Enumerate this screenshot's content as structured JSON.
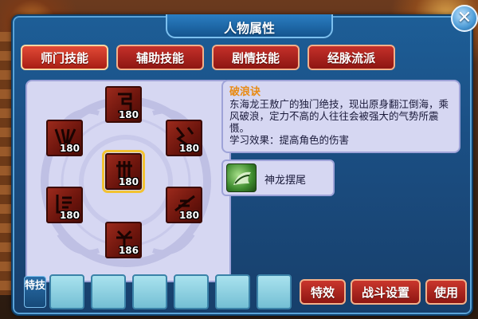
{
  "window": {
    "title": "人物属性"
  },
  "tabs": [
    {
      "label": "师门技能",
      "active": true
    },
    {
      "label": "辅助技能",
      "active": false
    },
    {
      "label": "剧情技能",
      "active": false
    },
    {
      "label": "经脉流派",
      "active": false
    }
  ],
  "skills": [
    {
      "level": "180",
      "icon": "dragon-seal-icon"
    },
    {
      "level": "180",
      "icon": "wave-seal-icon"
    },
    {
      "level": "180",
      "icon": "lightning-seal-icon"
    },
    {
      "level": "180",
      "icon": "dragon-king-seal-icon",
      "selected": true
    },
    {
      "level": "180",
      "icon": "shield-seal-icon"
    },
    {
      "level": "180",
      "icon": "spear-seal-icon"
    },
    {
      "level": "186",
      "icon": "tree-seal-icon"
    }
  ],
  "description": {
    "title": "破浪诀",
    "text": "东海龙王敖广的独门绝技，现出原身翻江倒海，乘风破浪，定力不高的人往往会被强大的气势所震慑。",
    "effect": "学习效果：提高角色的伤害"
  },
  "sub_skill": {
    "name": "神龙摆尾",
    "icon": "green-dragon-tail-icon"
  },
  "bottom": {
    "special_label": "特技",
    "slot_count": 6,
    "buttons": {
      "effects": "特效",
      "battle_settings": "战斗设置",
      "use": "使用"
    }
  },
  "colors": {
    "window_blue": "#1b4f84",
    "tab_red": "#a81e14",
    "panel_lavender": "#d6d7f2",
    "title_orange": "#e88a12",
    "selected_gold": "#f2c232"
  }
}
